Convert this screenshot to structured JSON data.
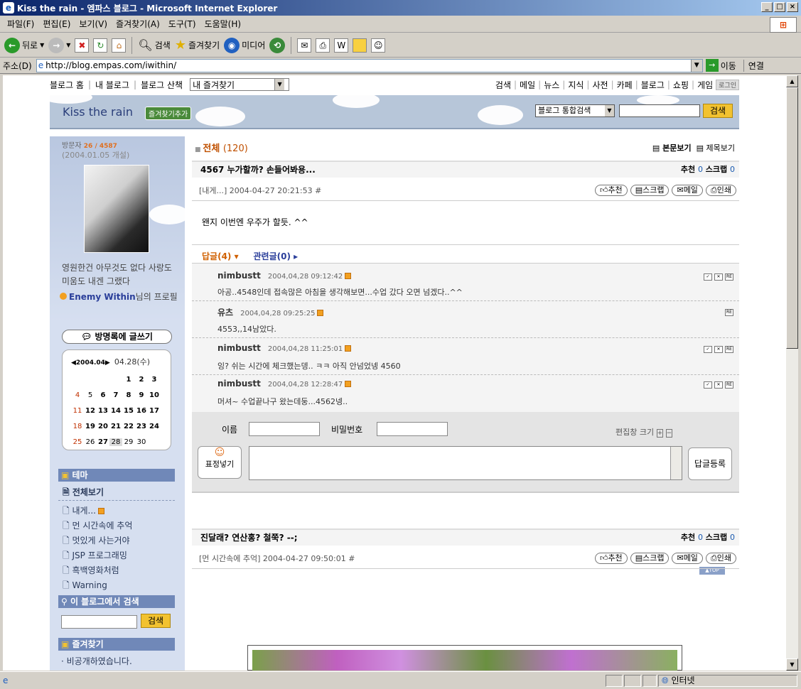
{
  "window": {
    "title": "Kiss the rain - 엠파스 블로그 - Microsoft Internet Explorer"
  },
  "menu": [
    "파일(F)",
    "편집(E)",
    "보기(V)",
    "즐겨찾기(A)",
    "도구(T)",
    "도움말(H)"
  ],
  "toolbar": {
    "back": "뒤로",
    "search": "검색",
    "favorites": "즐겨찾기",
    "media": "미디어"
  },
  "address": {
    "label": "주소(D)",
    "url": "http://blog.empas.com/iwithin/",
    "go": "이동",
    "links": "연결"
  },
  "status": {
    "zone": "인터넷"
  },
  "topnav": {
    "left": [
      "블로그 홈",
      "내 블로그",
      "블로그 산책"
    ],
    "select": "내 즐겨찾기",
    "right": [
      "검색",
      "메일",
      "뉴스",
      "지식",
      "사전",
      "카페",
      "블로그",
      "쇼핑",
      "게임"
    ],
    "login": "로그인"
  },
  "banner": {
    "title": "Kiss the rain",
    "fav": "즐겨찾기추가",
    "search_select": "블로그 통합검색",
    "search_btn": "검색"
  },
  "sidebar": {
    "visitor_label": "방문자",
    "visitor_count": "26 / 4587",
    "opened": "(2004.01.05 개설)",
    "motto": "영원한건 아무것도 없다 사랑도 미움도 내겐 그랬다",
    "profile_name": "Enemy Within",
    "profile_suffix": "님의 프로필",
    "guestbook": "방명록에 글쓰기",
    "calendar": {
      "month": "2004.04",
      "selected": "04.28(수)",
      "rows": [
        [
          "",
          "",
          "",
          "",
          "1",
          "2",
          "3"
        ],
        [
          "4",
          "5",
          "6",
          "7",
          "8",
          "9",
          "10"
        ],
        [
          "11",
          "12",
          "13",
          "14",
          "15",
          "16",
          "17"
        ],
        [
          "18",
          "19",
          "20",
          "21",
          "22",
          "23",
          "24"
        ],
        [
          "25",
          "26",
          "27",
          "28",
          "29",
          "30",
          ""
        ]
      ]
    },
    "theme_head": "테마",
    "all_view": "전체보기",
    "categories": [
      "내게...",
      "먼 시간속에 추억",
      "멋있게 사는거야",
      "JSP 프로그래밍",
      "흑백영화처럼",
      "Warning"
    ],
    "search_head": "이 블로그에서 검색",
    "search_btn": "검색",
    "fav_head": "즐겨찾기",
    "fav_private": "· 비공개하였습니다."
  },
  "main": {
    "all_label": "전체",
    "all_count": "(120)",
    "view_body": "본문보기",
    "view_title": "제목보기",
    "post1": {
      "title": "4567 누가할까? 손들어봐용...",
      "recommend": "추천",
      "recommend_count": "0",
      "scrap": "스크랩",
      "scrap_count": "0",
      "meta": "[내게...] 2004-04-27 20:21:53 #",
      "buttons": [
        "추천",
        "스크랩",
        "메일",
        "인쇄"
      ],
      "body": "왠지 이번엔 우주가 할듯. ^^",
      "replies_tab": "답글(4)",
      "related_tab": "관련글(0)",
      "comments": [
        {
          "name": "nimbustt",
          "date": "2004,04,28 09:12:42",
          "text": "아공..4548인데 접속많은 아침을 생각해보면...수업 갔다 오면 넘겠다..^^"
        },
        {
          "name": "유츠",
          "date": "2004,04,28 09:25:25",
          "text": "4553,,14남았다."
        },
        {
          "name": "nimbustt",
          "date": "2004,04,28 11:25:01",
          "text": "잉? 쉬는 시간에 체크했는뎅.. ㅋㅋ 아직 안넘었넹 4560"
        },
        {
          "name": "nimbustt",
          "date": "2004,04,28 12:28:47",
          "text": "머셔~ 수업끝나구 왔는데둥...4562넹.."
        }
      ],
      "form": {
        "name_label": "이름",
        "pw_label": "비밀번호",
        "editsize": "편집창 크기",
        "emoticon": "표정넣기",
        "submit": "답글등록"
      }
    },
    "top": "▲TOP",
    "post2": {
      "title": "진달래? 연산홍? 철쭉? --;",
      "recommend": "추천",
      "recommend_count": "0",
      "scrap": "스크랩",
      "scrap_count": "0",
      "meta": "[먼 시간속에 추억] 2004-04-27 09:50:01 #",
      "buttons": [
        "추천",
        "스크랩",
        "메일",
        "인쇄"
      ]
    }
  }
}
